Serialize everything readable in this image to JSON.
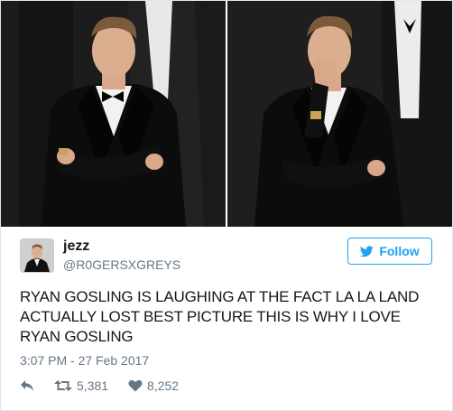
{
  "tweet": {
    "display_name": "jezz",
    "handle": "@R0GERSXGREYS",
    "follow_label": "Follow",
    "text": "RYAN GOSLING IS LAUGHING AT THE FACT LA LA LAND ACTUALLY LOST BEST PICTURE THIS IS WHY I LOVE RYAN GOSLING",
    "timestamp": "3:07 PM - 27 Feb 2017",
    "retweets": "5,381",
    "likes": "8,252"
  },
  "colors": {
    "accent": "#1da1f2",
    "secondary_text": "#657786",
    "primary_text": "#14171a"
  },
  "icons": [
    "bird-icon",
    "reply-icon",
    "retweet-icon",
    "heart-icon"
  ]
}
